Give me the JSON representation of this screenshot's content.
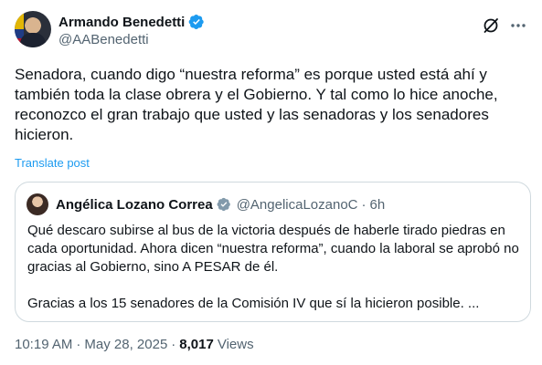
{
  "author": {
    "display_name": "Armando Benedetti",
    "handle": "@AABenedetti"
  },
  "tweet": {
    "text": "Senadora, cuando digo “nuestra reforma” es porque usted está ahí y también toda la clase obrera y el Gobierno. Y tal como lo hice anoche, reconozco el gran trabajo que usted y las senadoras y los senadores hicieron.",
    "translate_label": "Translate post"
  },
  "quoted": {
    "display_name": "Angélica Lozano Correa",
    "handle": "@AngelicaLozanoC",
    "separator": "·",
    "time": "6h",
    "paragraph1": "Qué descaro subirse al bus de la victoria después de haberle tirado piedras en cada oportunidad. Ahora dicen “nuestra reforma”, cuando la laboral se aprobó no gracias al Gobierno, sino A PESAR de él.",
    "paragraph2": "Gracias a los 15 senadores de la Comisión IV que sí la hicieron posible. ..."
  },
  "meta": {
    "time": "10:19 AM",
    "separator1": "·",
    "date": "May 28, 2025",
    "separator2": "·",
    "views_count": "8,017",
    "views_label": "Views"
  },
  "colors": {
    "verified": "#1d9bf0",
    "link": "#1d9bf0",
    "secondary_text": "#536471",
    "border": "#cfd9de"
  },
  "icons": {
    "verified": "verified-badge-icon",
    "grok": "grok-icon",
    "more": "more-icon"
  }
}
